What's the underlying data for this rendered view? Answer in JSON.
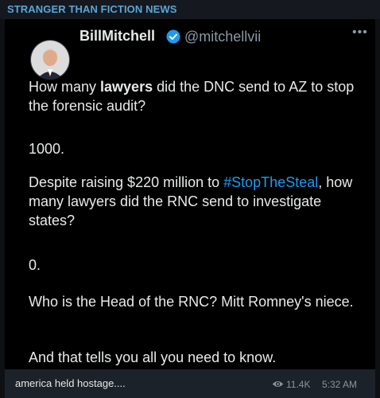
{
  "channel": {
    "name": "STRANGER THAN FICTION NEWS"
  },
  "tweet": {
    "author_name": "BillMitchell",
    "handle": "@mitchellvii",
    "more_icon": "more-horizontal-icon",
    "verified_icon": "verified-badge-icon",
    "line1_a": "How many ",
    "line1_bold": "lawyers",
    "line1_b": " did the DNC send to AZ to stop the forensic audit?",
    "p2": "1000.",
    "p3_a": "Despite raising $220 million to ",
    "p3_hashtag": "#StopTheSteal",
    "p3_b": ", how many lawyers did the RNC send to investigate states?",
    "p4": "0.",
    "p5": "Who is the Head of the RNC? Mitt Romney's niece.",
    "p6": "And that tells you all you need to know."
  },
  "footer": {
    "caption": "america held hostage....",
    "views_icon": "eye-icon",
    "views": "11.4K",
    "time": "5:32 AM"
  },
  "colors": {
    "channel_name": "#5aa6d6",
    "hashtag": "#1d9bf0",
    "verified": "#1d9bf0"
  }
}
